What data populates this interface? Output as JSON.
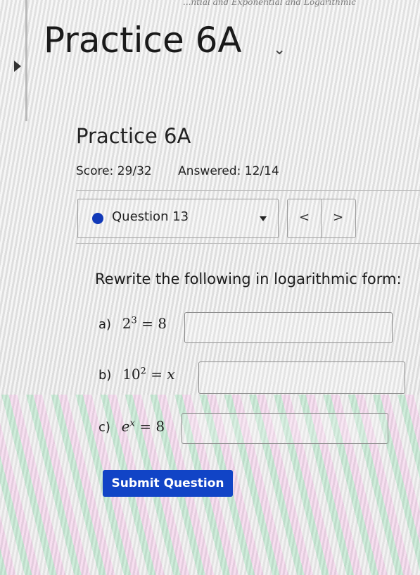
{
  "assignment": {
    "title": "Practice 6A"
  },
  "header_fragment": "...ntial and Exponential and Logarithmic",
  "homework": {
    "title": "Practice 6A",
    "score": "Score: 29/32",
    "answered": "Answered: 12/14"
  },
  "question_nav": {
    "label": "Question 13",
    "prev_icon": "<",
    "next_icon": ">"
  },
  "question": {
    "prompt": "Rewrite the following in logarithmic form:",
    "items": [
      {
        "label": "a)",
        "base": "2",
        "exp": "3",
        "eq": "=",
        "rhs": "8"
      },
      {
        "label": "b)",
        "base": "10",
        "exp": "2",
        "eq": "=",
        "rhs": "x"
      },
      {
        "label": "c)",
        "base": "e",
        "exp": "x",
        "eq": "=",
        "rhs": "8"
      }
    ]
  },
  "submit": {
    "label": "Submit Question"
  },
  "colors": {
    "accent": "#1144c6",
    "dot": "#1139b8"
  }
}
